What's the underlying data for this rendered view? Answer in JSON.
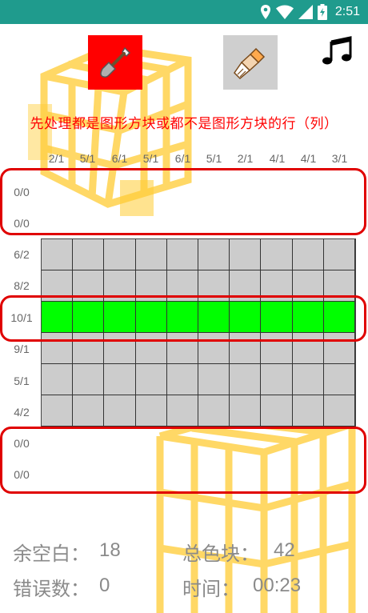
{
  "status_bar": {
    "time": "2:51",
    "icons": [
      "location-icon",
      "wifi-icon",
      "signal-icon",
      "battery-icon"
    ]
  },
  "toolbar": {
    "shovel_icon": "shovel-icon",
    "brush_icon": "brush-icon",
    "music_icon": "music-note-icon",
    "shovel_active_color": "#ff0000"
  },
  "hint": "先处理都是图形方块或都不是图形方块的行（列）",
  "column_clues": [
    "2/1",
    "5/1",
    "6/1",
    "5/1",
    "6/1",
    "5/1",
    "2/1",
    "4/1",
    "4/1",
    "3/1"
  ],
  "top_rows": [
    "0/0",
    "0/0"
  ],
  "grid_rows": [
    {
      "clue": "6/2",
      "filled": false
    },
    {
      "clue": "8/2",
      "filled": false
    },
    {
      "clue": "10/1",
      "filled": true
    },
    {
      "clue": "9/1",
      "filled": false
    },
    {
      "clue": "5/1",
      "filled": false
    },
    {
      "clue": "4/2",
      "filled": false
    }
  ],
  "bottom_rows": [
    "0/0",
    "0/0"
  ],
  "stats": {
    "blank_label": "余空白：",
    "blank_value": "18",
    "total_label": "总色块：",
    "total_value": "42",
    "errors_label": "错误数：",
    "errors_value": "0",
    "time_label": "时间：",
    "time_value": "00:23"
  },
  "colors": {
    "status_bar": "#1f9b8d",
    "filled_cell": "#00ff00",
    "empty_cell": "#cccccc",
    "highlight": "#e00000",
    "hint_text": "#ff0000"
  }
}
